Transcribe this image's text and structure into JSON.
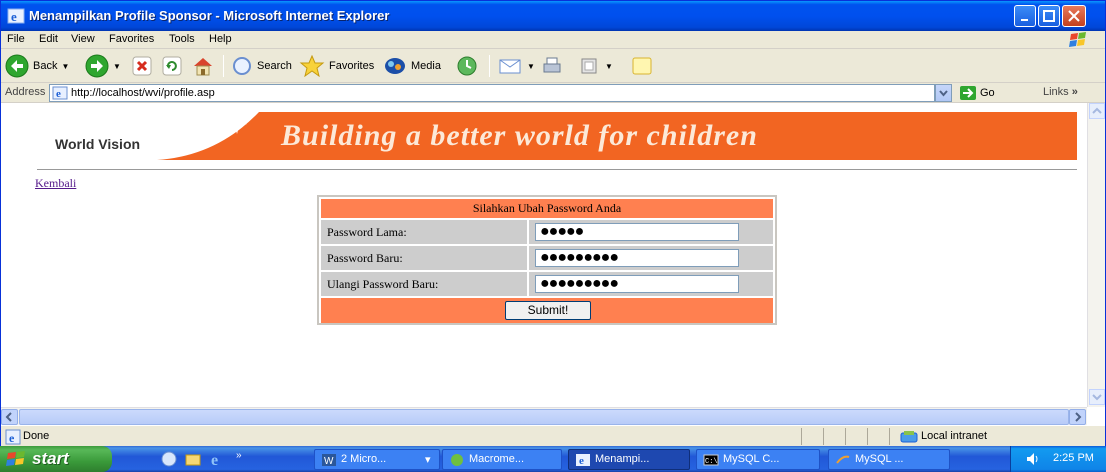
{
  "window": {
    "title": "Menampilkan Profile Sponsor - Microsoft Internet Explorer"
  },
  "menu": {
    "items": [
      "File",
      "Edit",
      "View",
      "Favorites",
      "Tools",
      "Help"
    ]
  },
  "toolbar": {
    "back_label": "Back",
    "search_label": "Search",
    "favorites_label": "Favorites",
    "media_label": "Media"
  },
  "address": {
    "label": "Address",
    "url": "http://localhost/wvi/profile.asp",
    "go_label": "Go",
    "links_label": "Links"
  },
  "page": {
    "logo_text": "World Vision",
    "slogan": "Building a better world for children",
    "back_link": "Kembali",
    "form": {
      "title": "Silahkan Ubah Password Anda",
      "rows": [
        {
          "label": "Password Lama:",
          "value": "●●●●●"
        },
        {
          "label": "Password Baru:",
          "value": "●●●●●●●●●"
        },
        {
          "label": "Ulangi Password Baru:",
          "value": "●●●●●●●●●"
        }
      ],
      "submit_label": "Submit!"
    }
  },
  "status": {
    "text": "Done",
    "zone": "Local intranet"
  },
  "taskbar": {
    "start_label": "start",
    "buttons": [
      {
        "label": "2 Micro...",
        "icon": "word-icon"
      },
      {
        "label": "Macrome...",
        "icon": "macromedia-icon"
      },
      {
        "label": "Menampi...",
        "icon": "ie-icon",
        "active": true
      },
      {
        "label": "MySQL C...",
        "icon": "mysql-console-icon"
      },
      {
        "label": "MySQL ...",
        "icon": "mysql-icon"
      }
    ],
    "clock": "2:25 PM"
  },
  "colors": {
    "banner_orange": "#F26522",
    "form_header": "#FF8050",
    "form_cell": "#CDCDCD",
    "xp_blue": "#0053EE"
  }
}
